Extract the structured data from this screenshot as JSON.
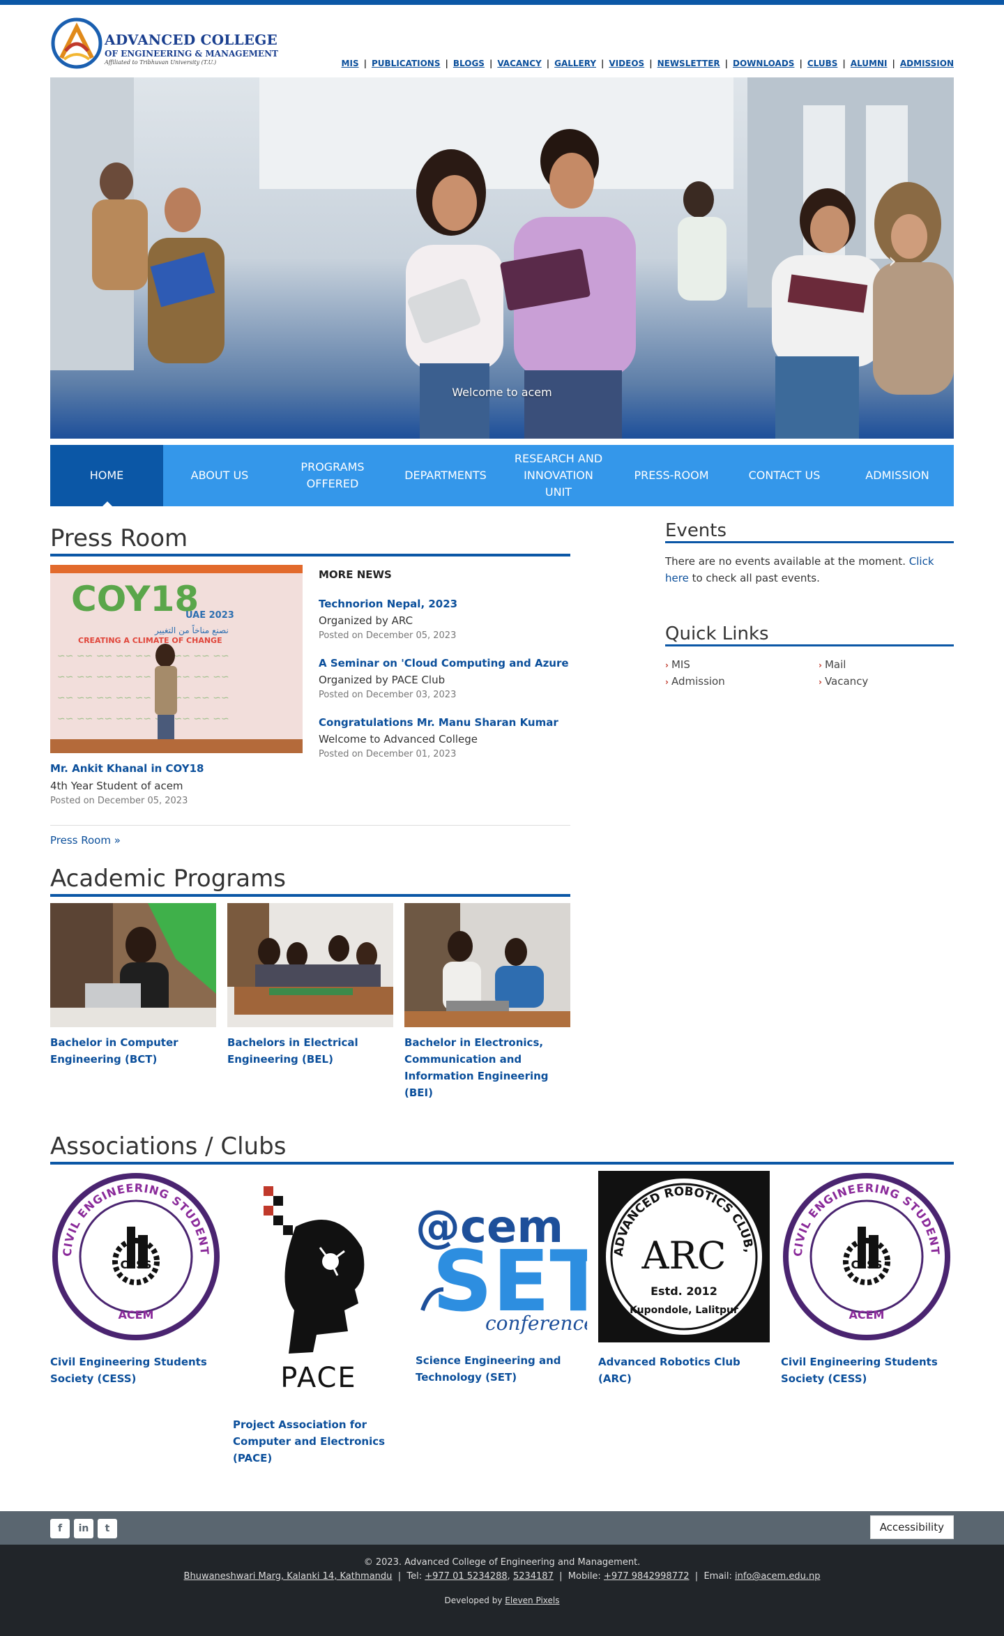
{
  "header": {
    "logo_name": "ADVANCED COLLEGE",
    "logo_sub": "OF ENGINEERING & MANAGEMENT",
    "logo_affiliation": "Affiliated to Tribhuvan University (T.U.)",
    "top_links": [
      "MIS",
      "PUBLICATIONS",
      "BLOGS",
      "VACANCY",
      "GALLERY",
      "VIDEOS",
      "NEWSLETTER",
      "DOWNLOADS",
      "CLUBS",
      "ALUMNI",
      "ADMISSION"
    ]
  },
  "hero": {
    "caption": "Welcome to acem"
  },
  "nav": {
    "items": [
      "HOME",
      "ABOUT US",
      "PROGRAMS OFFERED",
      "DEPARTMENTS",
      "RESEARCH AND INNOVATION UNIT",
      "PRESS-ROOM",
      "CONTACT US",
      "ADMISSION"
    ],
    "active": "HOME"
  },
  "press": {
    "title": "Press Room",
    "lead": {
      "title": "Mr. Ankit Khanal in COY18",
      "org": "4th Year Student of acem",
      "date": "Posted on December 05, 2023",
      "image_text": {
        "brand": "COY18",
        "sub": "UAE 2023",
        "arabic": "نصنع مناخاً من التغيير",
        "tagline": "CREATING A CLIMATE OF CHANGE"
      }
    },
    "more_label": "MORE NEWS",
    "news": [
      {
        "title": "Technorion Nepal, 2023",
        "org": "Organized by ARC",
        "date": "Posted on December 05, 2023"
      },
      {
        "title": "A Seminar on 'Cloud Computing and Azure",
        "org": "Organized by PACE Club",
        "date": "Posted on December 03, 2023"
      },
      {
        "title": "Congratulations Mr. Manu Sharan Kumar",
        "org": "Welcome to Advanced College",
        "date": "Posted on December 01, 2023"
      }
    ],
    "more_link": "Press Room »"
  },
  "academic": {
    "title": "Academic Programs",
    "programs": [
      "Bachelor in Computer Engineering (BCT)",
      "Bachelors in Electrical Engineering (BEL)",
      "Bachelor in Electronics, Communication and Information Engineering (BEI)"
    ]
  },
  "clubs": {
    "title": "Associations / Clubs",
    "items": [
      {
        "name": "Civil Engineering Students Society (CESS)",
        "logo_text": "CIVIL ENGINEERING STUDENTS SOCIETY",
        "logo_abbr": "CESS",
        "logo_bottom": "ACEM"
      },
      {
        "name": "Project Association for Computer and Electronics (PACE)",
        "logo_text": "PACE"
      },
      {
        "name": "Science Engineering and Technology (SET)",
        "logo_text": "@cem",
        "logo_abbr": "SET",
        "logo_bottom": "conference"
      },
      {
        "name": "Advanced Robotics Club (ARC)",
        "logo_text": "ADVANCED ROBOTICS CLUB, ACEM",
        "logo_abbr": "ARC",
        "logo_bottom": "Estd. 2012",
        "logo_place": "Kupondole, Lalitpur"
      },
      {
        "name": "Civil Engineering Students Society (CESS)",
        "logo_text": "CIVIL ENGINEERING STUDENTS SOCIETY",
        "logo_abbr": "CESS",
        "logo_bottom": "ACEM"
      }
    ]
  },
  "events": {
    "title": "Events",
    "text": "There are no events available at the moment.",
    "link": "Click here",
    "text_after": "to check all past events."
  },
  "quick_links": {
    "title": "Quick Links",
    "items": [
      "MIS",
      "Mail",
      "Admission",
      "Vacancy"
    ]
  },
  "footer": {
    "accessibility": "Accessibility",
    "copyright": "© 2023. Advanced College of Engineering and Management.",
    "address": "Bhuwaneshwari Marg, Kalanki 14, Kathmandu",
    "tel_label": "Tel:",
    "tel1": "+977 01 5234288",
    "tel2": "5234187",
    "mobile_label": "Mobile:",
    "mobile": "+977 9842998772",
    "email_label": "Email:",
    "email": "info@acem.edu.np",
    "dev_label": "Developed by",
    "dev": "Eleven Pixels"
  },
  "colors": {
    "brand_blue": "#0b57a6",
    "nav_blue": "#3497ea",
    "footer_gray": "#5a6670",
    "footer_dark": "#212529"
  }
}
